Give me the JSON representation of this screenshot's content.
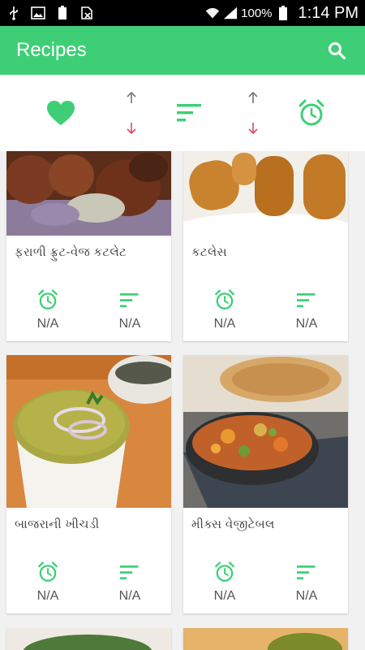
{
  "status_bar": {
    "icons_left": [
      "usb-icon",
      "image-icon",
      "battery-full-icon",
      "no-sim-icon"
    ],
    "signal_icons": [
      "wifi-icon",
      "signal-icon"
    ],
    "battery_percent": "100%",
    "time": "1:14 PM"
  },
  "app_bar": {
    "title": "Recipes",
    "search_icon": "search-icon"
  },
  "filters": {
    "favorite_icon": "heart-icon",
    "sort_by_time_icon": "alarm-icon",
    "sort_by_level_icon": "sort-lines-icon",
    "arrow_up_icon": "arrow-up-icon",
    "arrow_down_icon": "arrow-down-icon"
  },
  "colors": {
    "accent": "#3ecf76",
    "arrow_down": "#e0466a",
    "arrow_up": "#777777"
  },
  "recipes": [
    {
      "title": "ફરાળી ફ્રુટ-વેજ કટલેટ",
      "time": "N/A",
      "level": "N/A"
    },
    {
      "title": "કટલેસ",
      "time": "N/A",
      "level": "N/A"
    },
    {
      "title": "બાજરાની ખીચડી",
      "time": "N/A",
      "level": "N/A"
    },
    {
      "title": "મીક્સ વેજીટેબલ",
      "time": "N/A",
      "level": "N/A"
    }
  ]
}
